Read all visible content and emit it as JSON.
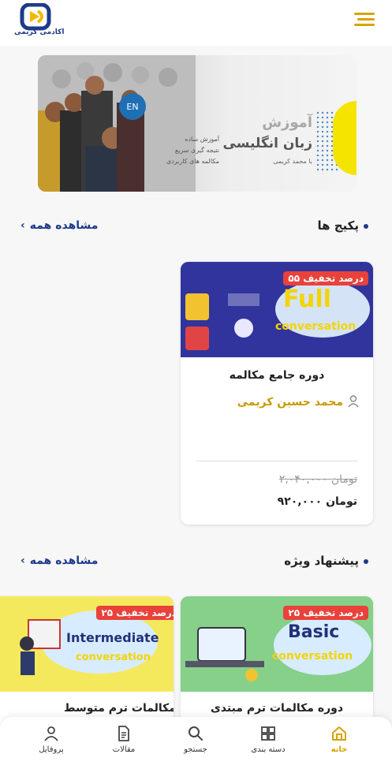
{
  "header": {
    "logo_text": "اکادمی کریمی"
  },
  "banner": {
    "badge": "EN",
    "title_line1": "آموزش",
    "title_line2": "زبان انگلیسی",
    "by": "با محمد کریمی",
    "sub_lines": [
      "آموزش ساده",
      "نتیجه گیری سریع",
      "مکالمه های کاربردی"
    ]
  },
  "packages": {
    "title": "پکیج ها",
    "see_all": "مشاهده همه",
    "cards": [
      {
        "discount": "۵۵ درصد تخفیف",
        "image_text": "Full",
        "image_sub": "conversation",
        "title": "دوره جامع مکالمه",
        "teacher": "محمد حسین کریمی",
        "price_old": "۲,۰۴۰,۰۰۰ تومان",
        "price_new": "۹۲۰,۰۰۰ تومان"
      }
    ]
  },
  "featured": {
    "title": "پیشنهاد ویژه",
    "see_all": "مشاهده همه",
    "cards": [
      {
        "discount": "۲۵ درصد تخفیف",
        "image_text": "Basic",
        "image_sub": "conversation",
        "title": "دوره مکالمات ترم مبتدی"
      },
      {
        "discount": "۲۵ درصد تخفیف",
        "image_text": "Intermediate",
        "image_sub": "conversation",
        "title": "دوره مکالمات ترم متوسط"
      }
    ]
  },
  "nav": {
    "items": [
      {
        "label": "خانه",
        "icon": "home-icon",
        "active": true
      },
      {
        "label": "دسته بندی",
        "icon": "grid-icon"
      },
      {
        "label": "جستجو",
        "icon": "search-icon"
      },
      {
        "label": "مقالات",
        "icon": "document-icon"
      },
      {
        "label": "پروفایل",
        "icon": "user-icon"
      }
    ]
  },
  "colors": {
    "accent": "#d8a300",
    "brand": "#1e3a8a",
    "discount": "#e8423b"
  }
}
